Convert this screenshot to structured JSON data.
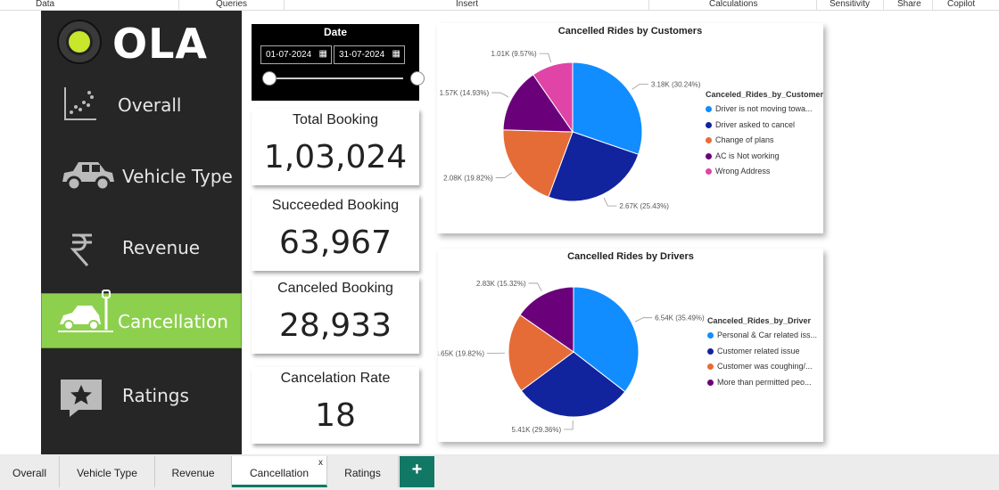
{
  "ribbon": {
    "data": "Data",
    "queries": "Queries",
    "insert": "Insert",
    "calculations": "Calculations",
    "sensitivity": "Sensitivity",
    "share": "Share",
    "copilot": "Copilot"
  },
  "brand": {
    "name": "OLA",
    "accent": "#c8e62c"
  },
  "nav": [
    {
      "label": "Overall",
      "icon": "scatter-chart-icon"
    },
    {
      "label": "Vehicle Type",
      "icon": "car-icon"
    },
    {
      "label": "Revenue",
      "icon": "rupee-icon"
    },
    {
      "label": "Cancellation",
      "icon": "car-crash-icon",
      "active": true,
      "color": "#8dd04e"
    },
    {
      "label": "Ratings",
      "icon": "star-comment-icon"
    }
  ],
  "date_filter": {
    "title": "Date",
    "start": "01-07-2024",
    "end": "31-07-2024"
  },
  "kpis": [
    {
      "title": "Total Booking",
      "value": "1,03,024"
    },
    {
      "title": "Succeeded Booking",
      "value": "63,967"
    },
    {
      "title": "Canceled Booking",
      "value": "28,933"
    },
    {
      "title": "Cancelation Rate",
      "value": "18"
    }
  ],
  "chart_data": [
    {
      "type": "pie",
      "title": "Cancelled Rides by Customers",
      "legend_title": "Canceled_Rides_by_Customer",
      "legend_placement": "right",
      "slices": [
        {
          "label": "Driver is not moving towa...",
          "value": 3180,
          "display": "3.18K (30.24%)",
          "color": "#118dff"
        },
        {
          "label": "Driver asked to cancel",
          "value": 2670,
          "display": "2.67K (25.43%)",
          "color": "#12239e"
        },
        {
          "label": "Change of plans",
          "value": 2080,
          "display": "2.08K (19.82%)",
          "color": "#e66c37"
        },
        {
          "label": "AC is Not working",
          "value": 1570,
          "display": "1.57K (14.93%)",
          "color": "#6b007b"
        },
        {
          "label": "Wrong Address",
          "value": 1010,
          "display": "1.01K (9.57%)",
          "color": "#e044a7"
        }
      ]
    },
    {
      "type": "pie",
      "title": "Cancelled Rides by Drivers",
      "legend_title": "Canceled_Rides_by_Driver",
      "legend_placement": "right",
      "slices": [
        {
          "label": "Personal & Car related iss...",
          "value": 6540,
          "display": "6.54K (35.49%)",
          "color": "#118dff"
        },
        {
          "label": "Customer related issue",
          "value": 5410,
          "display": "5.41K (29.36%)",
          "color": "#12239e"
        },
        {
          "label": "Customer was coughing/...",
          "value": 3650,
          "display": "3.65K (19.82%)",
          "color": "#e66c37"
        },
        {
          "label": "More than permitted peo...",
          "value": 2830,
          "display": "2.83K (15.32%)",
          "color": "#6b007b"
        }
      ]
    }
  ],
  "tabs": [
    {
      "label": "Overall"
    },
    {
      "label": "Vehicle Type"
    },
    {
      "label": "Revenue"
    },
    {
      "label": "Cancellation",
      "selected": true
    },
    {
      "label": "Ratings"
    }
  ],
  "close_glyph": "x",
  "add_tab_glyph": "+"
}
